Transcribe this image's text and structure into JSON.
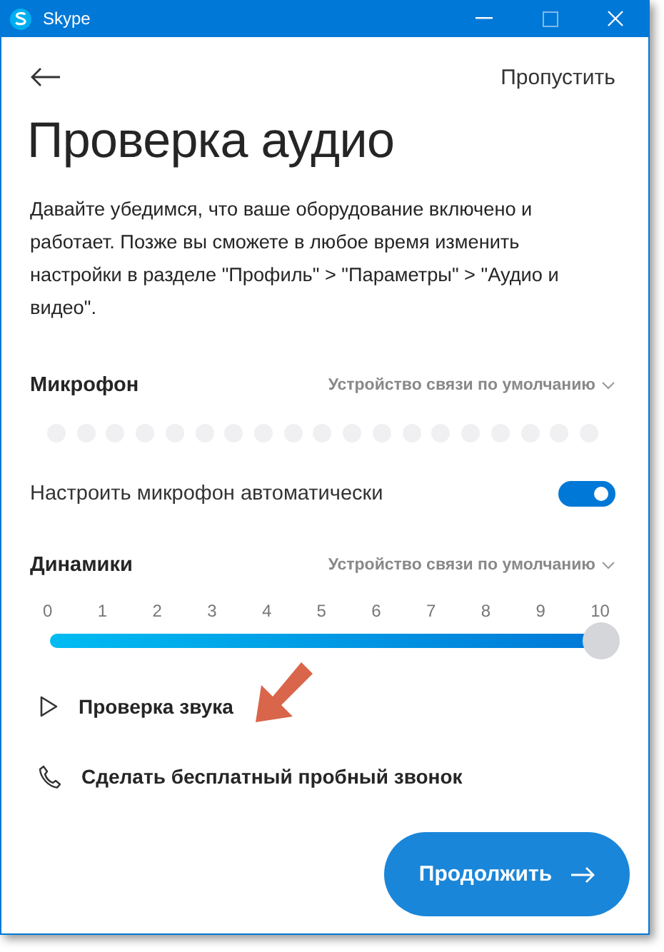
{
  "window": {
    "title": "Skype"
  },
  "header": {
    "skip_link": "Пропустить"
  },
  "title": "Проверка аудио",
  "description": "Давайте убедимся, что ваше оборудование включено и работает. Позже вы сможете в любое время изменить настройки в разделе \"Профиль\" > \"Параметры\" > \"Аудио и видео\".",
  "microphone": {
    "label": "Микрофон",
    "device": "Устройство связи по умолчанию"
  },
  "auto_adjust": {
    "label": "Настроить микрофон автоматически",
    "on": true
  },
  "speakers": {
    "label": "Динамики",
    "device": "Устройство связи по умолчанию",
    "ticks": [
      "0",
      "1",
      "2",
      "3",
      "4",
      "5",
      "6",
      "7",
      "8",
      "9",
      "10"
    ],
    "level": 1
  },
  "actions": [
    {
      "kind": "play",
      "label": "Проверка звука"
    },
    {
      "kind": "call",
      "label": "Сделать бесплатный пробный звонок"
    }
  ],
  "continue_button": "Продолжить"
}
